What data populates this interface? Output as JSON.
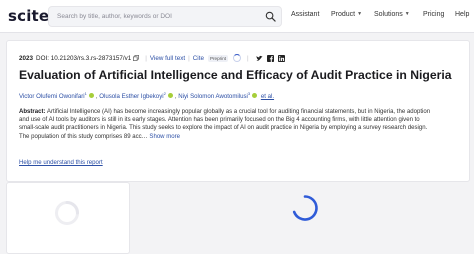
{
  "header": {
    "logo": "scite_",
    "search_placeholder": "Search by title, author, keywords or DOI",
    "nav": {
      "assistant": "Assistant",
      "product": "Product",
      "solutions": "Solutions",
      "pricing": "Pricing",
      "help": "Help"
    }
  },
  "paper": {
    "year": "2023",
    "doi": "DOI: 10.21203/rs.3.rs-2873157/v1",
    "view_full_text": "View full text",
    "cite": "Cite",
    "preprint_badge": "Preprint",
    "title": "Evaluation of Artificial Intelligence and Efficacy of Audit Practice in Nigeria",
    "authors": [
      {
        "name": "Victor Olufemi Owonifari",
        "sup": "1"
      },
      {
        "name": "Olusola Esther Igbekoyi",
        "sup": "2"
      },
      {
        "name": "Niyi Solomon Awotomilusi",
        "sup": "3"
      }
    ],
    "et_al": "et al.",
    "abstract_label": "Abstract:",
    "abstract_lines": [
      "Artificial Intelligence (AI) has become increasingly popular globally as a crucial tool for auditing financial statements, but in Nigeria, the adoption",
      "and use of AI tools by auditors is still in its early stages. Attention has been primarily focused on the Big 4 accounting firms, with little attention given to",
      "small-scale audit practitioners in Nigeria. This study seeks to explore the impact of AI on audit practice in Nigeria by employing a survey research design.",
      "The population of this study comprises 89 acc…"
    ],
    "show_more": "Show more",
    "help_link": "Help me understand this report"
  },
  "colors": {
    "link": "#2c4fa5",
    "spinner": "#2f5bd8",
    "orcid": "#a6ce39"
  },
  "icons": [
    "search-icon",
    "copy-icon",
    "twitter-icon",
    "facebook-icon",
    "linkedin-icon",
    "orcid-icon",
    "loading-spinner"
  ]
}
